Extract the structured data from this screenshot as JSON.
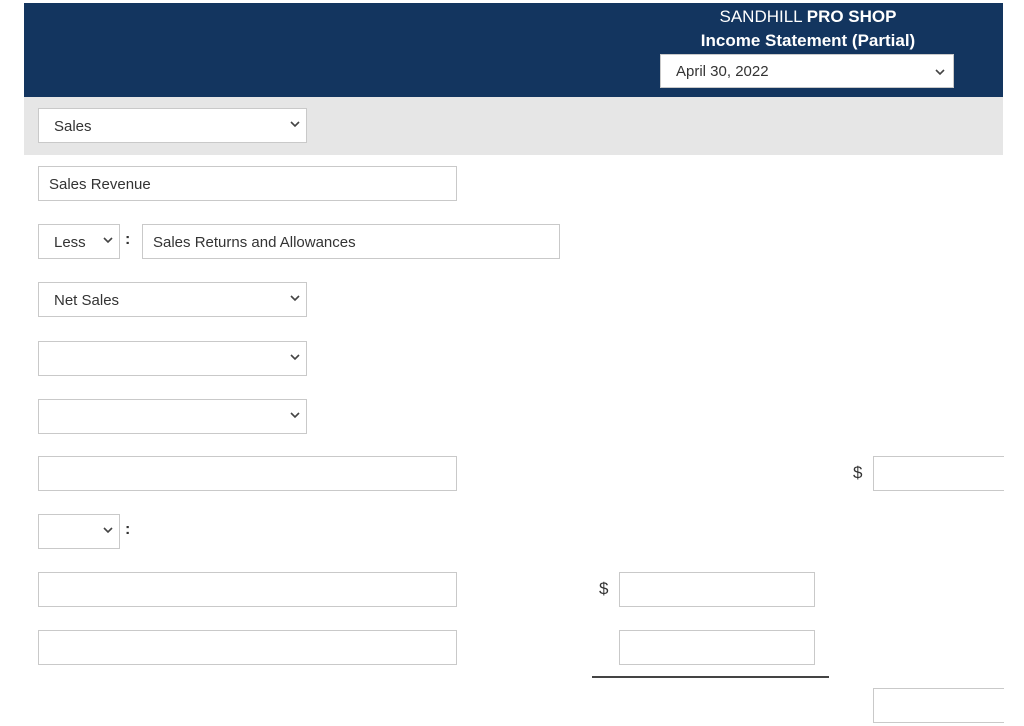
{
  "header": {
    "company_regular": "SANDHILL ",
    "company_bold": "PRO SHOP",
    "statement_title": "Income Statement (Partial)",
    "date_select_value": "April 30, 2022"
  },
  "rows": {
    "sales_select_value": "Sales",
    "sales_revenue_value": "Sales Revenue",
    "less_select_value": "Less",
    "returns_value": "Sales Returns and Allowances",
    "net_sales_select_value": "Net Sales",
    "blank_select_1_value": "",
    "blank_select_2_value": "",
    "blank_input_1_value": "",
    "small_select_value": "",
    "blank_input_2_value": "",
    "blank_input_3_value": ""
  },
  "amounts": {
    "dollar_sign": "$",
    "colon": ":",
    "right_amount_1_value": "",
    "middle_amount_1_value": "",
    "middle_amount_2_value": "",
    "right_amount_2_value": ""
  },
  "icons": {
    "chevron": "chevron-down-icon"
  }
}
